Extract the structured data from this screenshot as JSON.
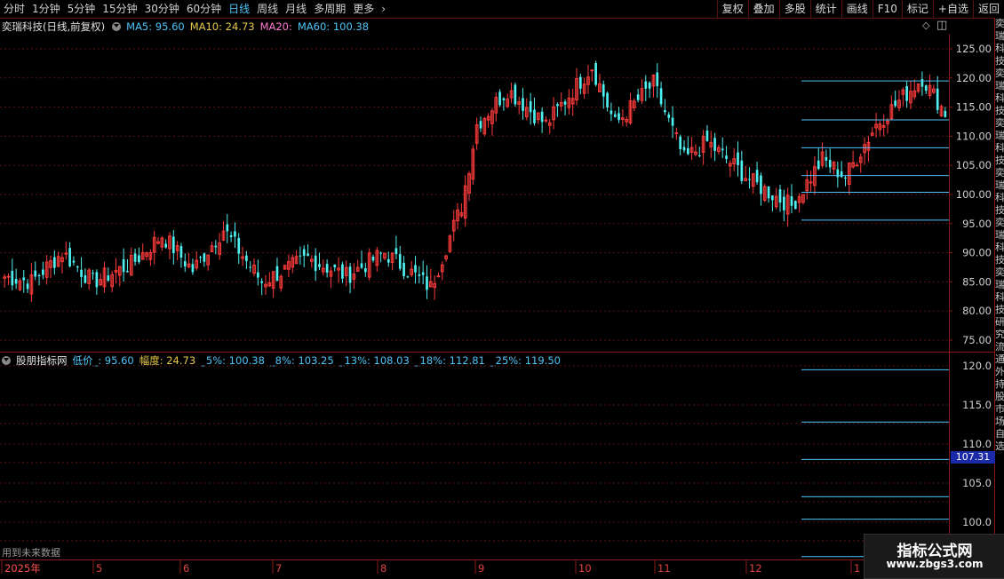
{
  "toolbar": {
    "periods": [
      "分时",
      "1分钟",
      "5分钟",
      "15分钟",
      "30分钟",
      "60分钟",
      "日线",
      "周线",
      "月线",
      "多周期",
      "更多"
    ],
    "active_period": "日线",
    "more_arrow": "›",
    "buttons": [
      "复权",
      "叠加",
      "多股",
      "统计",
      "画线",
      "F10",
      "标记",
      "+自选",
      "返回"
    ]
  },
  "main_header": {
    "title": "奕瑞科技(日线,前复权)",
    "ma5": "MA5: 95.60",
    "ma10": "MA10: 24.73",
    "ma20": "MA20:",
    "ma60": "MA60: 100.38",
    "colors": {
      "ma5": "#4fc3f7",
      "ma10": "#e6c84a",
      "ma20": "#ff7ad1",
      "ma60": "#4fc3f7"
    }
  },
  "sub_header": {
    "title": "股朋指标网",
    "low": "低价_: 95.60",
    "amp": "幅度: 24.73",
    "p5": "_5%: 100.38",
    "p8": "_8%: 103.25",
    "p13": "_13%: 108.03",
    "p18": "_18%: 112.81",
    "p25": "_25%: 119.50"
  },
  "sidebar_text": "奕瑞科技奕瑞科技奕瑞科技奕瑞科技奕瑞科技奕瑞科技研究流通外持股市场自选",
  "current_price": "107.31",
  "future_label": "用到未来数据",
  "watermark": {
    "title": "指标公式网",
    "url": "www.zbgs3.com"
  },
  "icons": {
    "diamond": "◇",
    "window": "◫"
  },
  "chart_data": [
    {
      "type": "candlestick",
      "title": "奕瑞科技(日线,前复权)",
      "y_ticks": [
        125.0,
        120.0,
        115.0,
        110.0,
        105.0,
        100.0,
        95.0,
        90.0,
        85.0,
        80.0,
        75.0
      ],
      "ylim": [
        73,
        128
      ],
      "x_ticks": [
        "2025年",
        "5",
        "6",
        "7",
        "8",
        "9",
        "10",
        "11",
        "12",
        "1"
      ],
      "colors": {
        "up": "#ff3c3c",
        "down": "#4ff0f0",
        "level": "#4fc3f7",
        "grid": "#5a1212"
      },
      "levels": [
        95.6,
        100.38,
        103.25,
        108.03,
        112.81,
        119.5
      ],
      "segments": [
        {
          "start": 86,
          "end": 85,
          "n": 8
        },
        {
          "start": 85,
          "end": 90,
          "n": 8
        },
        {
          "start": 90,
          "end": 85,
          "n": 8
        },
        {
          "start": 85,
          "end": 88,
          "n": 10
        },
        {
          "start": 88,
          "end": 93,
          "n": 8
        },
        {
          "start": 93,
          "end": 87,
          "n": 8
        },
        {
          "start": 87,
          "end": 94,
          "n": 8
        },
        {
          "start": 94,
          "end": 85,
          "n": 10
        },
        {
          "start": 85,
          "end": 89,
          "n": 12
        },
        {
          "start": 89,
          "end": 86,
          "n": 10
        },
        {
          "start": 86,
          "end": 90,
          "n": 10
        },
        {
          "start": 90,
          "end": 84,
          "n": 12
        },
        {
          "start": 84,
          "end": 98,
          "n": 8
        },
        {
          "start": 98,
          "end": 112,
          "n": 4
        },
        {
          "start": 112,
          "end": 118,
          "n": 8
        },
        {
          "start": 118,
          "end": 112,
          "n": 10
        },
        {
          "start": 112,
          "end": 122,
          "n": 12
        },
        {
          "start": 122,
          "end": 112,
          "n": 6
        },
        {
          "start": 112,
          "end": 119,
          "n": 10
        },
        {
          "start": 119,
          "end": 106,
          "n": 8
        },
        {
          "start": 106,
          "end": 109,
          "n": 6
        },
        {
          "start": 109,
          "end": 102,
          "n": 12
        },
        {
          "start": 102,
          "end": 98,
          "n": 10
        },
        {
          "start": 98,
          "end": 106,
          "n": 8
        },
        {
          "start": 106,
          "end": 103,
          "n": 6
        },
        {
          "start": 103,
          "end": 112,
          "n": 8
        },
        {
          "start": 112,
          "end": 120,
          "n": 12
        },
        {
          "start": 120,
          "end": 114,
          "n": 6
        }
      ]
    },
    {
      "type": "indicator",
      "title": "股朋指标网",
      "y_ticks": [
        120.0,
        115.0,
        110.0,
        105.0,
        100.0
      ],
      "ylim": [
        96.5,
        121.5
      ],
      "levels": [
        95.6,
        100.38,
        103.25,
        108.03,
        112.81,
        119.5
      ]
    }
  ]
}
